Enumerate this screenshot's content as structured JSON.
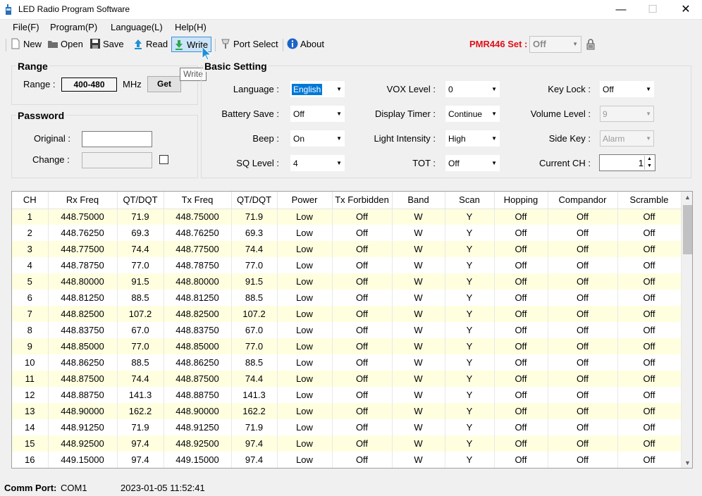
{
  "window": {
    "title": "LED Radio Program Software"
  },
  "menu": [
    "File(F)",
    "Program(P)",
    "Language(L)",
    "Help(H)"
  ],
  "toolbar": {
    "new_label": "New",
    "open_label": "Open",
    "save_label": "Save",
    "read_label": "Read",
    "write_label": "Write",
    "port_label": "Port Select",
    "about_label": "About",
    "tooltip": "Write"
  },
  "pmr": {
    "label": "PMR446 Set :",
    "value": "Off"
  },
  "range": {
    "title": "Range",
    "label": "Range :",
    "value": "400-480",
    "unit": "MHz",
    "get_label": "Get"
  },
  "password": {
    "title": "Password",
    "original_label": "Original :",
    "change_label": "Change :"
  },
  "basic": {
    "title": "Basic Setting",
    "language_label": "Language :",
    "language_value": "English",
    "battery_label": "Battery Save :",
    "battery_value": "Off",
    "beep_label": "Beep :",
    "beep_value": "On",
    "sq_label": "SQ Level :",
    "sq_value": "4",
    "vox_label": "VOX Level :",
    "vox_value": "0",
    "display_label": "Display Timer :",
    "display_value": "Continue",
    "light_label": "Light Intensity :",
    "light_value": "High",
    "tot_label": "TOT :",
    "tot_value": "Off",
    "keylock_label": "Key Lock :",
    "keylock_value": "Off",
    "volume_label": "Volume Level :",
    "volume_value": "9",
    "sidekey_label": "Side Key :",
    "sidekey_value": "Alarm",
    "current_label": "Current CH :",
    "current_value": "1"
  },
  "table": {
    "columns": [
      "CH",
      "Rx Freq",
      "QT/DQT",
      "Tx Freq",
      "QT/DQT",
      "Power",
      "Tx Forbidden",
      "Band",
      "Scan",
      "Hopping",
      "Compandor",
      "Scramble"
    ],
    "rows": [
      [
        "1",
        "448.75000",
        "71.9",
        "448.75000",
        "71.9",
        "Low",
        "Off",
        "W",
        "Y",
        "Off",
        "Off",
        "Off"
      ],
      [
        "2",
        "448.76250",
        "69.3",
        "448.76250",
        "69.3",
        "Low",
        "Off",
        "W",
        "Y",
        "Off",
        "Off",
        "Off"
      ],
      [
        "3",
        "448.77500",
        "74.4",
        "448.77500",
        "74.4",
        "Low",
        "Off",
        "W",
        "Y",
        "Off",
        "Off",
        "Off"
      ],
      [
        "4",
        "448.78750",
        "77.0",
        "448.78750",
        "77.0",
        "Low",
        "Off",
        "W",
        "Y",
        "Off",
        "Off",
        "Off"
      ],
      [
        "5",
        "448.80000",
        "91.5",
        "448.80000",
        "91.5",
        "Low",
        "Off",
        "W",
        "Y",
        "Off",
        "Off",
        "Off"
      ],
      [
        "6",
        "448.81250",
        "88.5",
        "448.81250",
        "88.5",
        "Low",
        "Off",
        "W",
        "Y",
        "Off",
        "Off",
        "Off"
      ],
      [
        "7",
        "448.82500",
        "107.2",
        "448.82500",
        "107.2",
        "Low",
        "Off",
        "W",
        "Y",
        "Off",
        "Off",
        "Off"
      ],
      [
        "8",
        "448.83750",
        "67.0",
        "448.83750",
        "67.0",
        "Low",
        "Off",
        "W",
        "Y",
        "Off",
        "Off",
        "Off"
      ],
      [
        "9",
        "448.85000",
        "77.0",
        "448.85000",
        "77.0",
        "Low",
        "Off",
        "W",
        "Y",
        "Off",
        "Off",
        "Off"
      ],
      [
        "10",
        "448.86250",
        "88.5",
        "448.86250",
        "88.5",
        "Low",
        "Off",
        "W",
        "Y",
        "Off",
        "Off",
        "Off"
      ],
      [
        "11",
        "448.87500",
        "74.4",
        "448.87500",
        "74.4",
        "Low",
        "Off",
        "W",
        "Y",
        "Off",
        "Off",
        "Off"
      ],
      [
        "12",
        "448.88750",
        "141.3",
        "448.88750",
        "141.3",
        "Low",
        "Off",
        "W",
        "Y",
        "Off",
        "Off",
        "Off"
      ],
      [
        "13",
        "448.90000",
        "162.2",
        "448.90000",
        "162.2",
        "Low",
        "Off",
        "W",
        "Y",
        "Off",
        "Off",
        "Off"
      ],
      [
        "14",
        "448.91250",
        "71.9",
        "448.91250",
        "71.9",
        "Low",
        "Off",
        "W",
        "Y",
        "Off",
        "Off",
        "Off"
      ],
      [
        "15",
        "448.92500",
        "97.4",
        "448.92500",
        "97.4",
        "Low",
        "Off",
        "W",
        "Y",
        "Off",
        "Off",
        "Off"
      ],
      [
        "16",
        "449.15000",
        "97.4",
        "449.15000",
        "97.4",
        "Low",
        "Off",
        "W",
        "Y",
        "Off",
        "Off",
        "Off"
      ]
    ]
  },
  "status": {
    "port_label": "Comm Port:",
    "port_value": "COM1",
    "datetime": "2023-01-05 11:52:41"
  },
  "colors": {
    "pmr_red": "#e0101a",
    "row_highlight": "#ffffe0",
    "selection_blue": "#0078d7"
  }
}
